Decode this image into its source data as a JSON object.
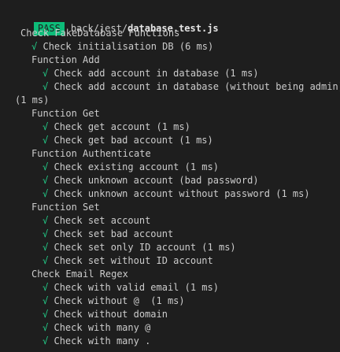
{
  "header": {
    "status": "PASS",
    "path_dir": "back/jest/",
    "path_file": "database.test.js"
  },
  "colors": {
    "background": "#1e1e1e",
    "pass_badge": "#0dbc79",
    "check_mark": "#23d18b",
    "text": "#cccccc"
  },
  "lines": [
    {
      "indent": 2,
      "mark": "",
      "text": "Check FakeDatabase Functions"
    },
    {
      "indent": 4,
      "mark": "√",
      "text": "Check initialisation DB (6 ms)"
    },
    {
      "indent": 4,
      "mark": "",
      "text": "Function Add"
    },
    {
      "indent": 6,
      "mark": "√",
      "text": "Check add account in database (1 ms)"
    },
    {
      "indent": 6,
      "mark": "√",
      "text": "Check add account in database (without being admin)"
    },
    {
      "indent": 0,
      "mark": "",
      "text": "(1 ms)"
    },
    {
      "indent": 4,
      "mark": "",
      "text": "Function Get"
    },
    {
      "indent": 6,
      "mark": "√",
      "text": "Check get account (1 ms)"
    },
    {
      "indent": 6,
      "mark": "√",
      "text": "Check get bad account (1 ms)"
    },
    {
      "indent": 4,
      "mark": "",
      "text": "Function Authenticate"
    },
    {
      "indent": 6,
      "mark": "√",
      "text": "Check existing account (1 ms)"
    },
    {
      "indent": 6,
      "mark": "√",
      "text": "Check unknown account (bad password)"
    },
    {
      "indent": 6,
      "mark": "√",
      "text": "Check unknown account without password (1 ms)"
    },
    {
      "indent": 4,
      "mark": "",
      "text": "Function Set"
    },
    {
      "indent": 6,
      "mark": "√",
      "text": "Check set account"
    },
    {
      "indent": 6,
      "mark": "√",
      "text": "Check set bad account"
    },
    {
      "indent": 6,
      "mark": "√",
      "text": "Check set only ID account (1 ms)"
    },
    {
      "indent": 6,
      "mark": "√",
      "text": "Check set without ID account"
    },
    {
      "indent": 4,
      "mark": "",
      "text": "Check Email Regex"
    },
    {
      "indent": 6,
      "mark": "√",
      "text": "Check with valid email (1 ms)"
    },
    {
      "indent": 6,
      "mark": "√",
      "text": "Check without @  (1 ms)"
    },
    {
      "indent": 6,
      "mark": "√",
      "text": "Check without domain"
    },
    {
      "indent": 6,
      "mark": "√",
      "text": "Check with many @"
    },
    {
      "indent": 6,
      "mark": "√",
      "text": "Check with many ."
    }
  ]
}
